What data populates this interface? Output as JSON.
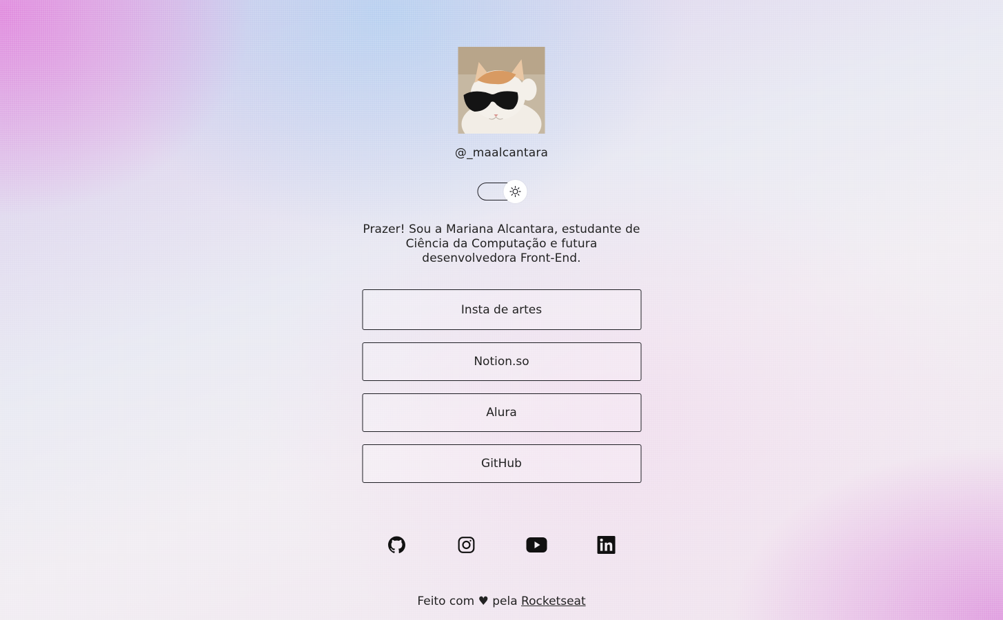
{
  "profile": {
    "username": "@_maalcantara",
    "avatar_icon": "cat-with-sunglasses",
    "bio": "Prazer! Sou a Mariana Alcantara, estudante de Ciência da Computação e futura desenvolvedora Front-End."
  },
  "theme_switch": {
    "icon": "sun-icon",
    "state": "light"
  },
  "links": [
    {
      "label": "Insta de artes"
    },
    {
      "label": "Notion.so"
    },
    {
      "label": "Alura"
    },
    {
      "label": "GitHub"
    }
  ],
  "social": [
    {
      "icon": "github-icon"
    },
    {
      "icon": "instagram-icon"
    },
    {
      "icon": "youtube-icon"
    },
    {
      "icon": "linkedin-icon"
    }
  ],
  "footer": {
    "prefix": "Feito com ♥ pela ",
    "link_label": "Rocketseat"
  },
  "colors": {
    "text": "#1f1f24",
    "border": "#1e1e24",
    "accent_pink": "#e282dc",
    "accent_blue": "#b2d0f0"
  }
}
